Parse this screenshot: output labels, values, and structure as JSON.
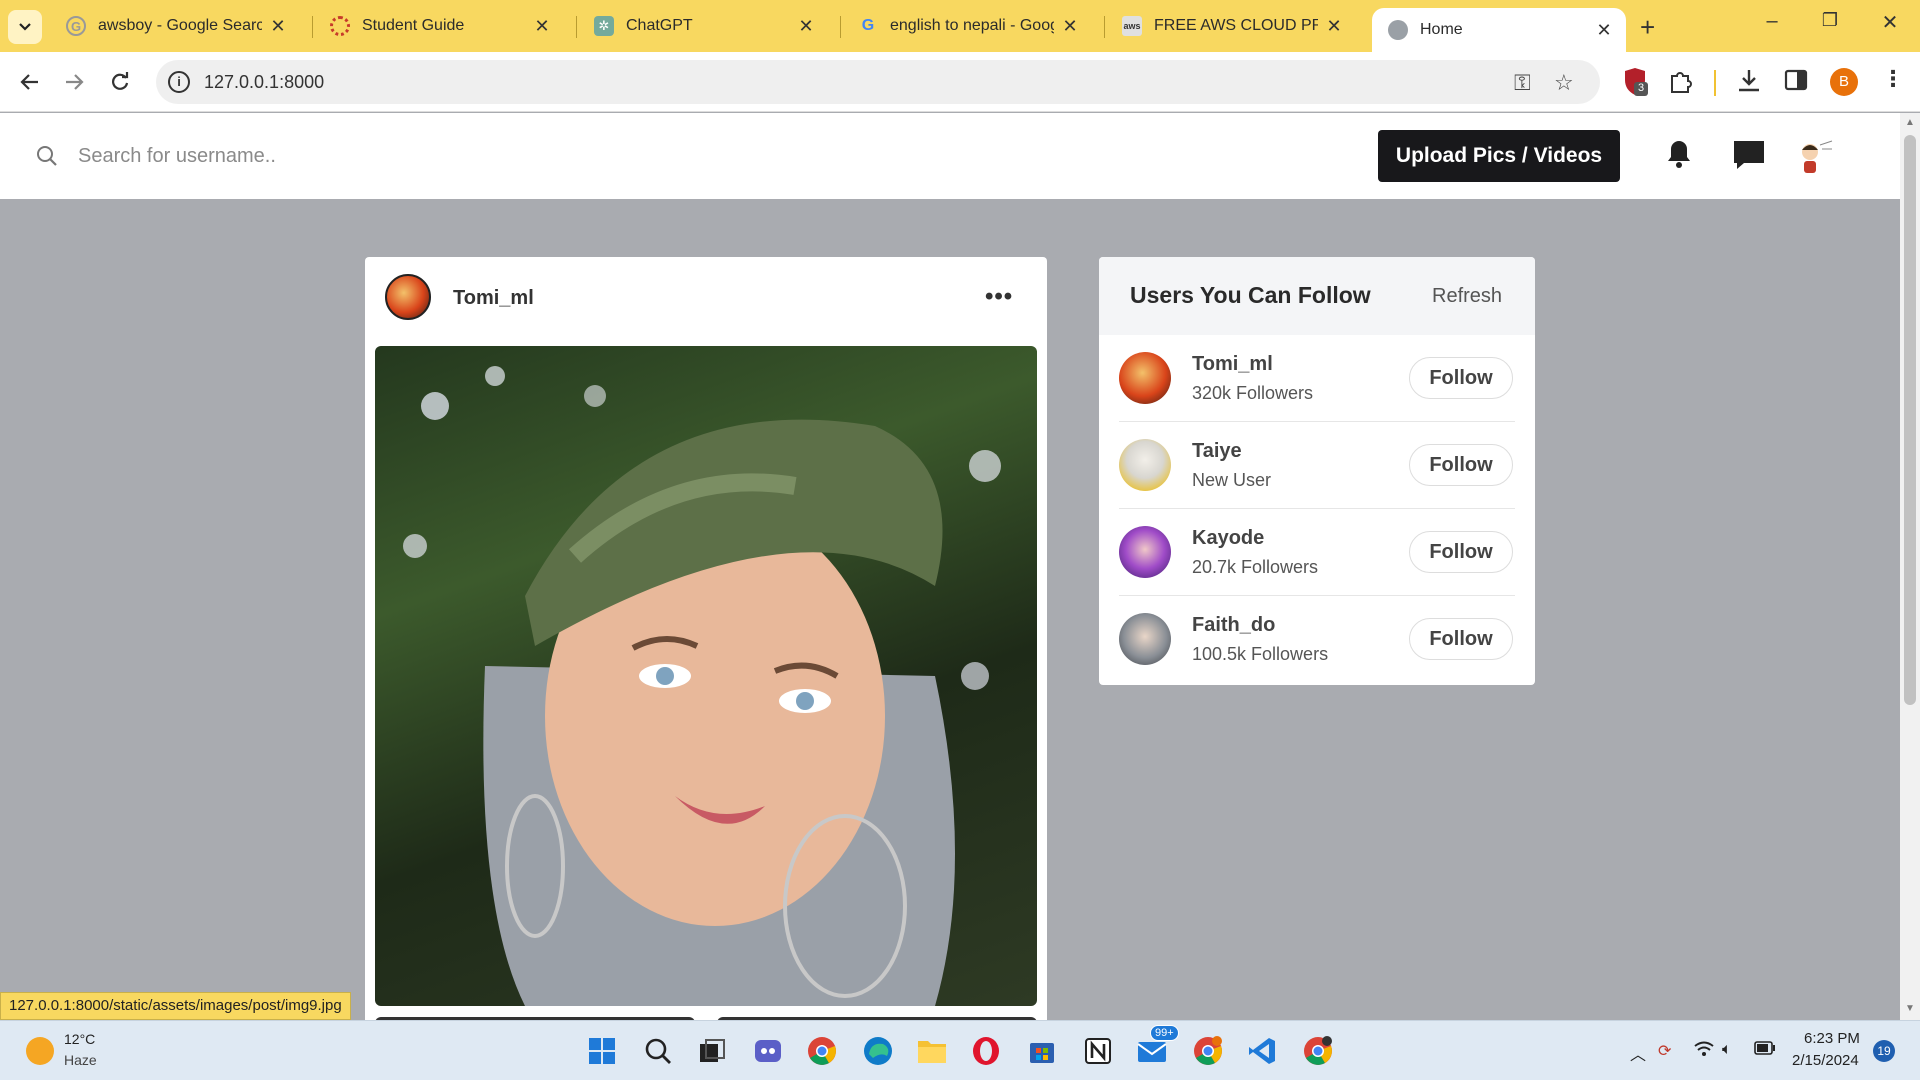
{
  "browser": {
    "tabs": [
      {
        "title": "awsboy - Google Search",
        "icon": "google-icon"
      },
      {
        "title": "Student Guide",
        "icon": "student-guide-icon"
      },
      {
        "title": "ChatGPT",
        "icon": "chatgpt-icon"
      },
      {
        "title": "english to nepali - Googl",
        "icon": "google-icon"
      },
      {
        "title": "FREE AWS CLOUD PRACT",
        "icon": "aws-course-icon"
      },
      {
        "title": "Home",
        "icon": "globe-icon"
      }
    ],
    "url": "127.0.0.1:8000",
    "extension_badge": "3",
    "profile_initial": "B"
  },
  "header": {
    "search_placeholder": "Search for username..",
    "upload_label": "Upload Pics / Videos"
  },
  "post": {
    "username": "Tomi_ml",
    "more": "•••"
  },
  "suggestions": {
    "title": "Users You Can Follow",
    "refresh_label": "Refresh",
    "users": [
      {
        "name": "Tomi_ml",
        "sub": "320k Followers",
        "button": "Follow",
        "color": "#d9441a"
      },
      {
        "name": "Taiye",
        "sub": "New User",
        "button": "Follow",
        "color": "#e8c23a"
      },
      {
        "name": "Kayode",
        "sub": "20.7k Followers",
        "button": "Follow",
        "color": "#7a3fc8"
      },
      {
        "name": "Faith_do",
        "sub": "100.5k Followers",
        "button": "Follow",
        "color": "#8a8f96"
      }
    ]
  },
  "status_url": "127.0.0.1:8000/static/assets/images/post/img9.jpg",
  "taskbar": {
    "weather_temp": "12°C",
    "weather_desc": "Haze",
    "mail_badge": "99+",
    "time": "6:23 PM",
    "date": "2/15/2024",
    "notifications": "19"
  }
}
